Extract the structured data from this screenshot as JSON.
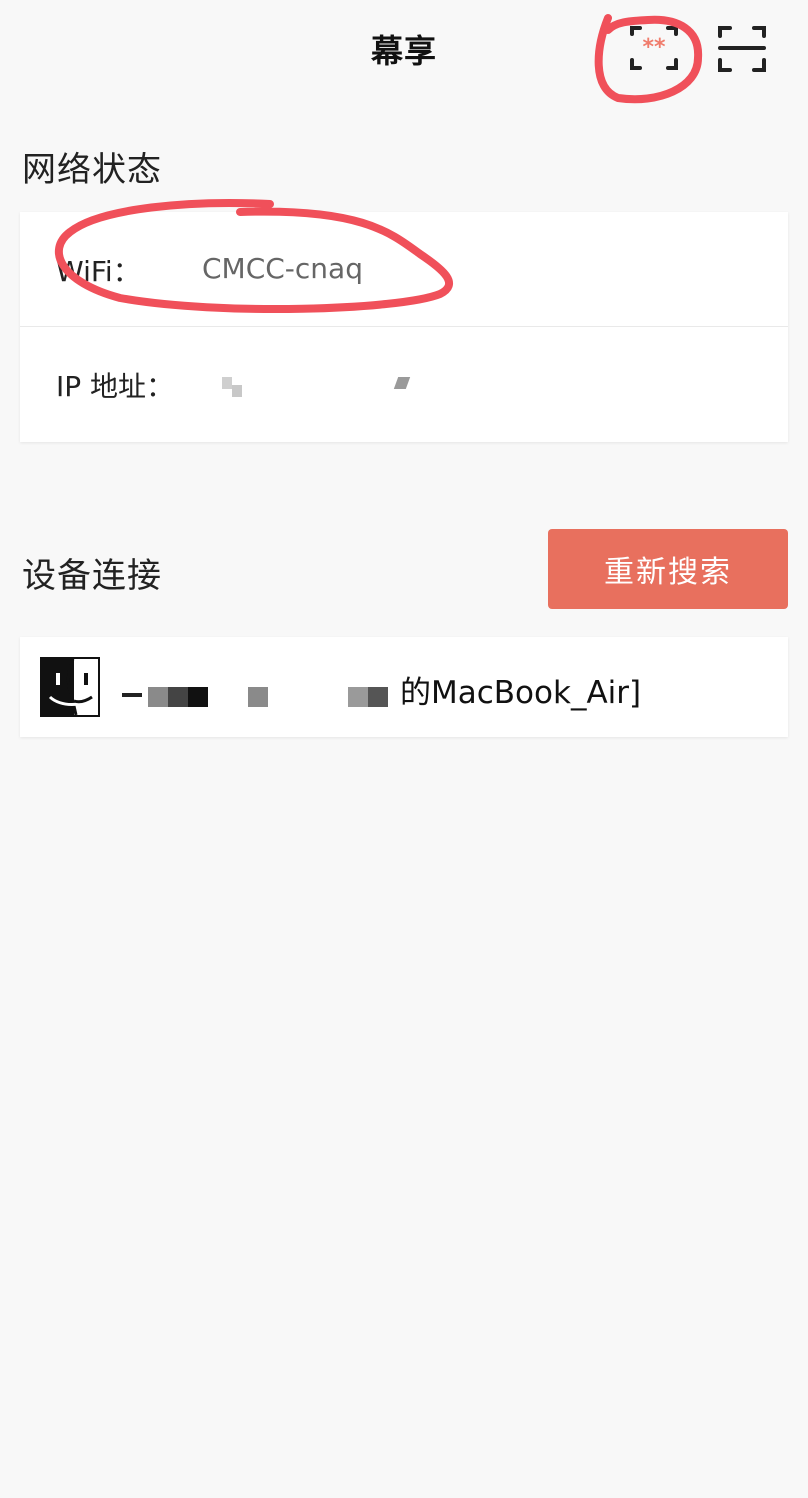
{
  "header": {
    "title": "幕享",
    "mirror_icon": "screen-mirror-icon",
    "scan_icon": "qr-scan-icon"
  },
  "network_status": {
    "section_title": "网络状态",
    "wifi_label": "WiFi：",
    "wifi_value": "CMCC-cnaq",
    "ip_label": "IP 地址："
  },
  "device_connect": {
    "section_title": "设备连接",
    "refresh_button": "重新搜索",
    "devices": [
      {
        "icon": "finder-icon",
        "name_visible": "的MacBook_Air]"
      }
    ]
  },
  "colors": {
    "accent": "#e8705e",
    "annotation": "#f0505a",
    "background": "#f8f8f8",
    "card": "#ffffff"
  }
}
